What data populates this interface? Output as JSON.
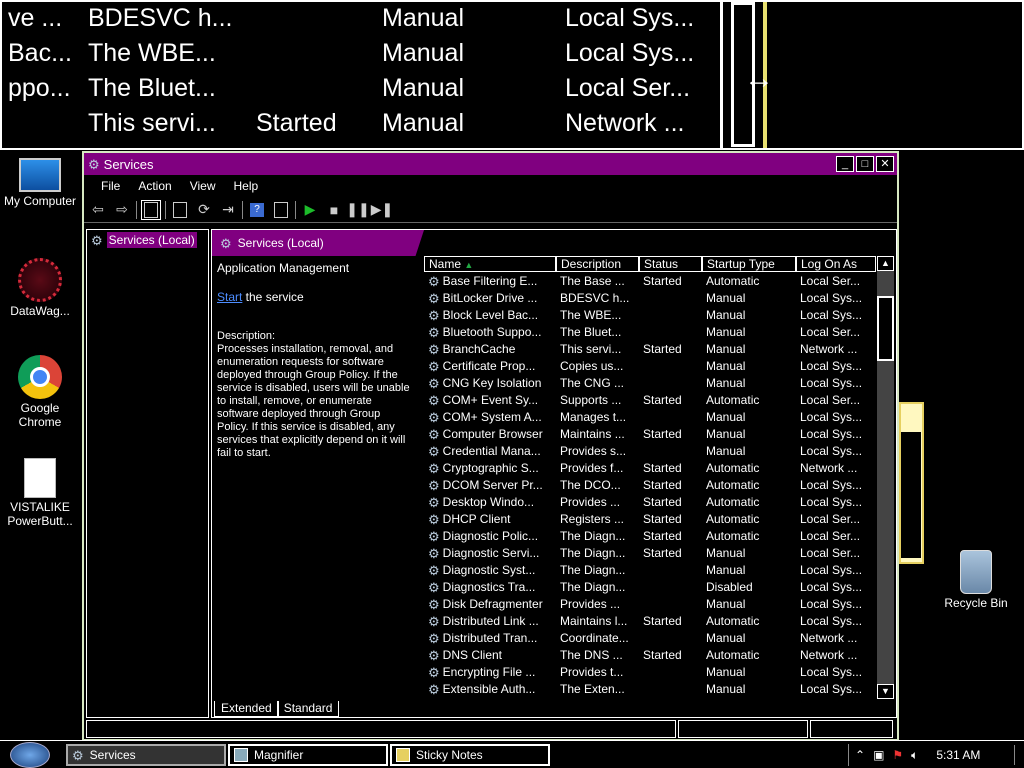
{
  "magnifier": {
    "rows": [
      {
        "c1": "ve ...",
        "c2": "BDESVC h...",
        "c3": "",
        "c4": "Manual",
        "c5": "Local Sys..."
      },
      {
        "c1": "Bac...",
        "c2": "The WBE...",
        "c3": "",
        "c4": "Manual",
        "c5": "Local Sys..."
      },
      {
        "c1": "ppo...",
        "c2": "The Bluet...",
        "c3": "",
        "c4": "Manual",
        "c5": "Local Ser..."
      },
      {
        "c1": "",
        "c2": "This servi...",
        "c3": "Started",
        "c4": "Manual",
        "c5": "Network ..."
      }
    ],
    "cursor_icon": "resize-horizontal-cursor"
  },
  "desktop": {
    "icons": [
      {
        "label": "My Computer",
        "icon": "computer-icon"
      },
      {
        "label": "DataWag...",
        "icon": "datawag-icon"
      },
      {
        "label": "Google Chrome",
        "icon": "chrome-icon"
      },
      {
        "label": "VISTALIKE PowerButt...",
        "icon": "document-icon"
      },
      {
        "label": "Recycle Bin",
        "icon": "recycle-bin-icon"
      }
    ]
  },
  "window": {
    "title": "Services",
    "controls": {
      "minimize": "_",
      "maximize": "□",
      "close": "✕"
    },
    "menu": [
      "File",
      "Action",
      "View",
      "Help"
    ],
    "tree_item": "Services (Local)",
    "pane_title": "Services (Local)",
    "selected_service": "Application Management",
    "start_link": "Start",
    "start_rest": " the service",
    "description_label": "Description:",
    "description": "Processes installation, removal, and enumeration requests for software deployed through Group Policy. If the service is disabled, users will be unable to install, remove, or enumerate software deployed through Group Policy. If this service is disabled, any services that explicitly depend on it will fail to start.",
    "columns": [
      "Name",
      "Description",
      "Status",
      "Startup Type",
      "Log On As"
    ],
    "sort_indicator": "▲",
    "tabs": [
      "Extended",
      "Standard"
    ],
    "accent_color": "#800080"
  },
  "services": [
    {
      "name": "Base Filtering E...",
      "desc": "The Base ...",
      "status": "Started",
      "startup": "Automatic",
      "logon": "Local Ser..."
    },
    {
      "name": "BitLocker Drive ...",
      "desc": "BDESVC h...",
      "status": "",
      "startup": "Manual",
      "logon": "Local Sys..."
    },
    {
      "name": "Block Level Bac...",
      "desc": "The WBE...",
      "status": "",
      "startup": "Manual",
      "logon": "Local Sys..."
    },
    {
      "name": "Bluetooth Suppo...",
      "desc": "The Bluet...",
      "status": "",
      "startup": "Manual",
      "logon": "Local Ser..."
    },
    {
      "name": "BranchCache",
      "desc": "This servi...",
      "status": "Started",
      "startup": "Manual",
      "logon": "Network ..."
    },
    {
      "name": "Certificate Prop...",
      "desc": "Copies us...",
      "status": "",
      "startup": "Manual",
      "logon": "Local Sys..."
    },
    {
      "name": "CNG Key Isolation",
      "desc": "The CNG ...",
      "status": "",
      "startup": "Manual",
      "logon": "Local Sys..."
    },
    {
      "name": "COM+ Event Sy...",
      "desc": "Supports ...",
      "status": "Started",
      "startup": "Automatic",
      "logon": "Local Ser..."
    },
    {
      "name": "COM+ System A...",
      "desc": "Manages t...",
      "status": "",
      "startup": "Manual",
      "logon": "Local Sys..."
    },
    {
      "name": "Computer Browser",
      "desc": "Maintains ...",
      "status": "Started",
      "startup": "Manual",
      "logon": "Local Sys..."
    },
    {
      "name": "Credential Mana...",
      "desc": "Provides s...",
      "status": "",
      "startup": "Manual",
      "logon": "Local Sys..."
    },
    {
      "name": "Cryptographic S...",
      "desc": "Provides f...",
      "status": "Started",
      "startup": "Automatic",
      "logon": "Network ..."
    },
    {
      "name": "DCOM Server Pr...",
      "desc": "The DCO...",
      "status": "Started",
      "startup": "Automatic",
      "logon": "Local Sys..."
    },
    {
      "name": "Desktop Windo...",
      "desc": "Provides ...",
      "status": "Started",
      "startup": "Automatic",
      "logon": "Local Sys..."
    },
    {
      "name": "DHCP Client",
      "desc": "Registers ...",
      "status": "Started",
      "startup": "Automatic",
      "logon": "Local Ser..."
    },
    {
      "name": "Diagnostic Polic...",
      "desc": "The Diagn...",
      "status": "Started",
      "startup": "Automatic",
      "logon": "Local Ser..."
    },
    {
      "name": "Diagnostic Servi...",
      "desc": "The Diagn...",
      "status": "Started",
      "startup": "Manual",
      "logon": "Local Ser..."
    },
    {
      "name": "Diagnostic Syst...",
      "desc": "The Diagn...",
      "status": "",
      "startup": "Manual",
      "logon": "Local Sys..."
    },
    {
      "name": "Diagnostics Tra...",
      "desc": "The Diagn...",
      "status": "",
      "startup": "Disabled",
      "logon": "Local Sys..."
    },
    {
      "name": "Disk Defragmenter",
      "desc": "Provides ...",
      "status": "",
      "startup": "Manual",
      "logon": "Local Sys..."
    },
    {
      "name": "Distributed Link ...",
      "desc": "Maintains l...",
      "status": "Started",
      "startup": "Automatic",
      "logon": "Local Sys..."
    },
    {
      "name": "Distributed Tran...",
      "desc": "Coordinate...",
      "status": "",
      "startup": "Manual",
      "logon": "Network ..."
    },
    {
      "name": "DNS Client",
      "desc": "The DNS ...",
      "status": "Started",
      "startup": "Automatic",
      "logon": "Network ..."
    },
    {
      "name": "Encrypting File ...",
      "desc": "Provides t...",
      "status": "",
      "startup": "Manual",
      "logon": "Local Sys..."
    },
    {
      "name": "Extensible Auth...",
      "desc": "The Exten...",
      "status": "",
      "startup": "Manual",
      "logon": "Local Sys..."
    }
  ],
  "taskbar": {
    "tasks": [
      "Services",
      "Magnifier",
      "Sticky Notes"
    ],
    "tray_icons": [
      "show-hidden-icons",
      "network-icon",
      "action-center-icon",
      "volume-icon"
    ],
    "clock": "5:31 AM"
  }
}
